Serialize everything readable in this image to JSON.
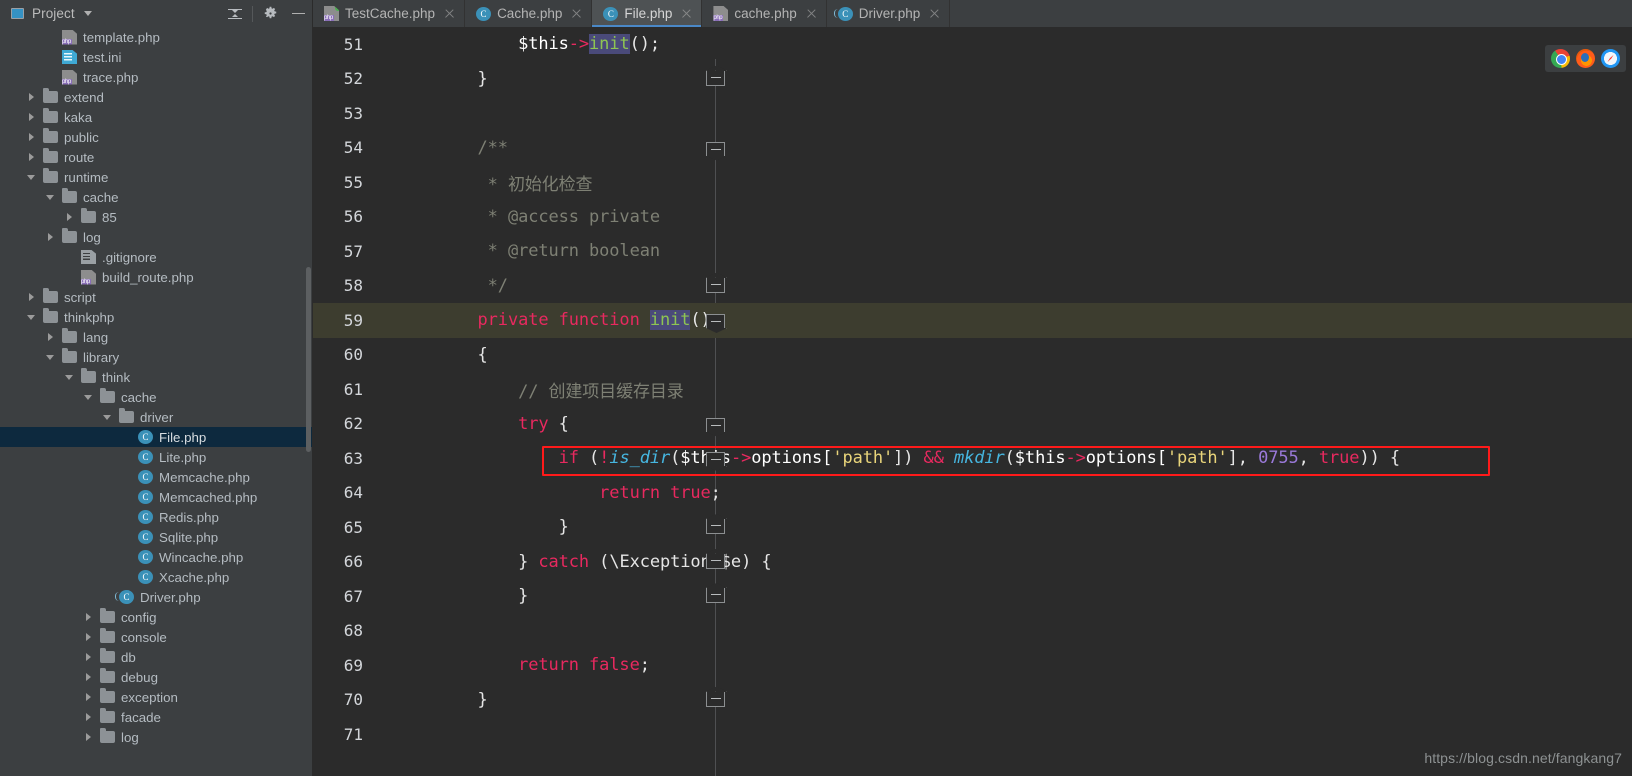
{
  "project_panel": {
    "title": "Project",
    "caret_icon": "chevron-down-icon",
    "collapse_all_icon": "collapse-all-icon",
    "settings_icon": "gear-icon",
    "hide_icon": "minimize-icon",
    "tree": [
      {
        "label": "template.php",
        "depth": 2,
        "icon": "php-file-icon",
        "arrow": "none"
      },
      {
        "label": "test.ini",
        "depth": 2,
        "icon": "ini-file-icon",
        "arrow": "none"
      },
      {
        "label": "trace.php",
        "depth": 2,
        "icon": "php-file-icon",
        "arrow": "none"
      },
      {
        "label": "extend",
        "depth": 1,
        "icon": "folder-icon",
        "arrow": "right"
      },
      {
        "label": "kaka",
        "depth": 1,
        "icon": "folder-icon",
        "arrow": "right"
      },
      {
        "label": "public",
        "depth": 1,
        "icon": "folder-icon",
        "arrow": "right"
      },
      {
        "label": "route",
        "depth": 1,
        "icon": "folder-icon",
        "arrow": "right"
      },
      {
        "label": "runtime",
        "depth": 1,
        "icon": "folder-icon",
        "arrow": "down"
      },
      {
        "label": "cache",
        "depth": 2,
        "icon": "folder-icon",
        "arrow": "down"
      },
      {
        "label": "85",
        "depth": 3,
        "icon": "folder-icon",
        "arrow": "right"
      },
      {
        "label": "log",
        "depth": 2,
        "icon": "folder-icon",
        "arrow": "right"
      },
      {
        "label": ".gitignore",
        "depth": 3,
        "icon": "gitignore-file-icon",
        "arrow": "none"
      },
      {
        "label": "build_route.php",
        "depth": 3,
        "icon": "php-file-icon",
        "arrow": "none"
      },
      {
        "label": "script",
        "depth": 1,
        "icon": "folder-icon",
        "arrow": "right"
      },
      {
        "label": "thinkphp",
        "depth": 1,
        "icon": "folder-icon",
        "arrow": "down"
      },
      {
        "label": "lang",
        "depth": 2,
        "icon": "folder-icon",
        "arrow": "right"
      },
      {
        "label": "library",
        "depth": 2,
        "icon": "folder-icon",
        "arrow": "down"
      },
      {
        "label": "think",
        "depth": 3,
        "icon": "folder-icon",
        "arrow": "down"
      },
      {
        "label": "cache",
        "depth": 4,
        "icon": "folder-icon",
        "arrow": "down"
      },
      {
        "label": "driver",
        "depth": 5,
        "icon": "folder-icon",
        "arrow": "down"
      },
      {
        "label": "File.php",
        "depth": 6,
        "icon": "class-file-icon",
        "arrow": "none",
        "selected": true
      },
      {
        "label": "Lite.php",
        "depth": 6,
        "icon": "class-file-icon",
        "arrow": "none"
      },
      {
        "label": "Memcache.php",
        "depth": 6,
        "icon": "class-file-icon",
        "arrow": "none"
      },
      {
        "label": "Memcached.php",
        "depth": 6,
        "icon": "class-file-icon",
        "arrow": "none"
      },
      {
        "label": "Redis.php",
        "depth": 6,
        "icon": "class-file-icon",
        "arrow": "none"
      },
      {
        "label": "Sqlite.php",
        "depth": 6,
        "icon": "class-file-icon",
        "arrow": "none"
      },
      {
        "label": "Wincache.php",
        "depth": 6,
        "icon": "class-file-icon",
        "arrow": "none"
      },
      {
        "label": "Xcache.php",
        "depth": 6,
        "icon": "class-file-icon",
        "arrow": "none"
      },
      {
        "label": "Driver.php",
        "depth": 5,
        "icon": "abstract-class-file-icon",
        "arrow": "none"
      },
      {
        "label": "config",
        "depth": 4,
        "icon": "folder-icon",
        "arrow": "right"
      },
      {
        "label": "console",
        "depth": 4,
        "icon": "folder-icon",
        "arrow": "right"
      },
      {
        "label": "db",
        "depth": 4,
        "icon": "folder-icon",
        "arrow": "right"
      },
      {
        "label": "debug",
        "depth": 4,
        "icon": "folder-icon",
        "arrow": "right"
      },
      {
        "label": "exception",
        "depth": 4,
        "icon": "folder-icon",
        "arrow": "right"
      },
      {
        "label": "facade",
        "depth": 4,
        "icon": "folder-icon",
        "arrow": "right"
      },
      {
        "label": "log",
        "depth": 4,
        "icon": "folder-icon",
        "arrow": "right"
      }
    ]
  },
  "tabs": [
    {
      "label": "TestCache.php",
      "icon": "php-file-icon-modified",
      "active": false,
      "closable": true
    },
    {
      "label": "Cache.php",
      "icon": "class-file-icon",
      "active": false,
      "closable": true
    },
    {
      "label": "File.php",
      "icon": "class-file-icon",
      "active": true,
      "closable": true
    },
    {
      "label": "cache.php",
      "icon": "php-file-icon",
      "active": false,
      "closable": true
    },
    {
      "label": "Driver.php",
      "icon": "abstract-class-file-icon",
      "active": false,
      "closable": true
    }
  ],
  "editor": {
    "first_line": 51,
    "highlighted_line": 59,
    "annotated_line": 63,
    "lines": [
      {
        "n": 51,
        "tokens": [
          {
            "t": "        $this",
            "c": "var"
          },
          {
            "t": "->",
            "c": "arr"
          },
          {
            "t": "init",
            "c": "sel-ident"
          },
          {
            "t": "();",
            "c": "op"
          }
        ]
      },
      {
        "n": 52,
        "tokens": [
          {
            "t": "    }",
            "c": "op"
          }
        ],
        "fold": "endUp"
      },
      {
        "n": 53,
        "tokens": []
      },
      {
        "n": 54,
        "tokens": [
          {
            "t": "    /**",
            "c": "cmt"
          }
        ],
        "fold": "start"
      },
      {
        "n": 55,
        "tokens": [
          {
            "t": "     * 初始化检查",
            "c": "cmt"
          }
        ]
      },
      {
        "n": 56,
        "tokens": [
          {
            "t": "     * @access private",
            "c": "cmt"
          }
        ]
      },
      {
        "n": 57,
        "tokens": [
          {
            "t": "     * @return boolean",
            "c": "cmt"
          }
        ]
      },
      {
        "n": 58,
        "tokens": [
          {
            "t": "     */",
            "c": "cmt"
          }
        ],
        "fold": "endUp"
      },
      {
        "n": 59,
        "tokens": [
          {
            "t": "    private function ",
            "c": "kwm"
          },
          {
            "t": "init",
            "c": "sel-ident"
          },
          {
            "t": "()",
            "c": "op"
          }
        ],
        "fold": "start",
        "highlight": true
      },
      {
        "n": 60,
        "tokens": [
          {
            "t": "    {",
            "c": "op"
          }
        ]
      },
      {
        "n": 61,
        "tokens": [
          {
            "t": "        // 创建项目缓存目录",
            "c": "cmt"
          }
        ]
      },
      {
        "n": 62,
        "tokens": [
          {
            "t": "        try",
            "c": "kwm"
          },
          {
            "t": " {",
            "c": "op"
          }
        ],
        "fold": "start"
      },
      {
        "n": 63,
        "tokens": [
          {
            "t": "            if",
            "c": "kwm"
          },
          {
            "t": " (",
            "c": "op"
          },
          {
            "t": "!",
            "c": "kwm"
          },
          {
            "t": "is_dir",
            "c": "fnb"
          },
          {
            "t": "(",
            "c": "op"
          },
          {
            "t": "$this",
            "c": "var"
          },
          {
            "t": "->",
            "c": "arr"
          },
          {
            "t": "options[",
            "c": "var"
          },
          {
            "t": "'path'",
            "c": "str"
          },
          {
            "t": "])",
            "c": "op"
          },
          {
            "t": " && ",
            "c": "kwm"
          },
          {
            "t": "mkdir",
            "c": "fnb"
          },
          {
            "t": "(",
            "c": "op"
          },
          {
            "t": "$this",
            "c": "var"
          },
          {
            "t": "->",
            "c": "arr"
          },
          {
            "t": "options[",
            "c": "var"
          },
          {
            "t": "'path'",
            "c": "str"
          },
          {
            "t": "], ",
            "c": "op"
          },
          {
            "t": "0755",
            "c": "num"
          },
          {
            "t": ", ",
            "c": "op"
          },
          {
            "t": "true",
            "c": "kwm"
          },
          {
            "t": "))",
            "c": "op"
          },
          {
            "t": " {",
            "c": "op"
          }
        ],
        "fold": "start",
        "annotated": true
      },
      {
        "n": 64,
        "tokens": [
          {
            "t": "                return true",
            "c": "kwm"
          },
          {
            "t": ";",
            "c": "op"
          }
        ]
      },
      {
        "n": 65,
        "tokens": [
          {
            "t": "            }",
            "c": "op"
          }
        ],
        "fold": "endUp"
      },
      {
        "n": 66,
        "tokens": [
          {
            "t": "        } ",
            "c": "op"
          },
          {
            "t": "catch",
            "c": "kwm"
          },
          {
            "t": " (\\Exception $e) {",
            "c": "op"
          }
        ],
        "fold": "endUp"
      },
      {
        "n": 67,
        "tokens": [
          {
            "t": "        }",
            "c": "op"
          }
        ],
        "fold": "endUp"
      },
      {
        "n": 68,
        "tokens": []
      },
      {
        "n": 69,
        "tokens": [
          {
            "t": "        return false",
            "c": "kwm"
          },
          {
            "t": ";",
            "c": "op"
          }
        ]
      },
      {
        "n": 70,
        "tokens": [
          {
            "t": "    }",
            "c": "op"
          }
        ],
        "fold": "endUp"
      },
      {
        "n": 71,
        "tokens": []
      }
    ],
    "browser_icons": [
      "chrome-icon",
      "firefox-icon",
      "safari-icon"
    ]
  },
  "watermark": "https://blog.csdn.net/fangkang7",
  "colors": {
    "panel_bg": "#3c3f41",
    "editor_bg": "#2b2b2b",
    "selection_bg": "#0d293e",
    "caret_line_bg": "#3d3d2f",
    "tab_active_underline": "#4a88c7",
    "annotation_box": "#ff1a1a",
    "keyword": "#e8295f",
    "string": "#e8d47a",
    "number": "#9a79d9",
    "comment": "#7e8074",
    "builtin_fn": "#46b6e0"
  }
}
